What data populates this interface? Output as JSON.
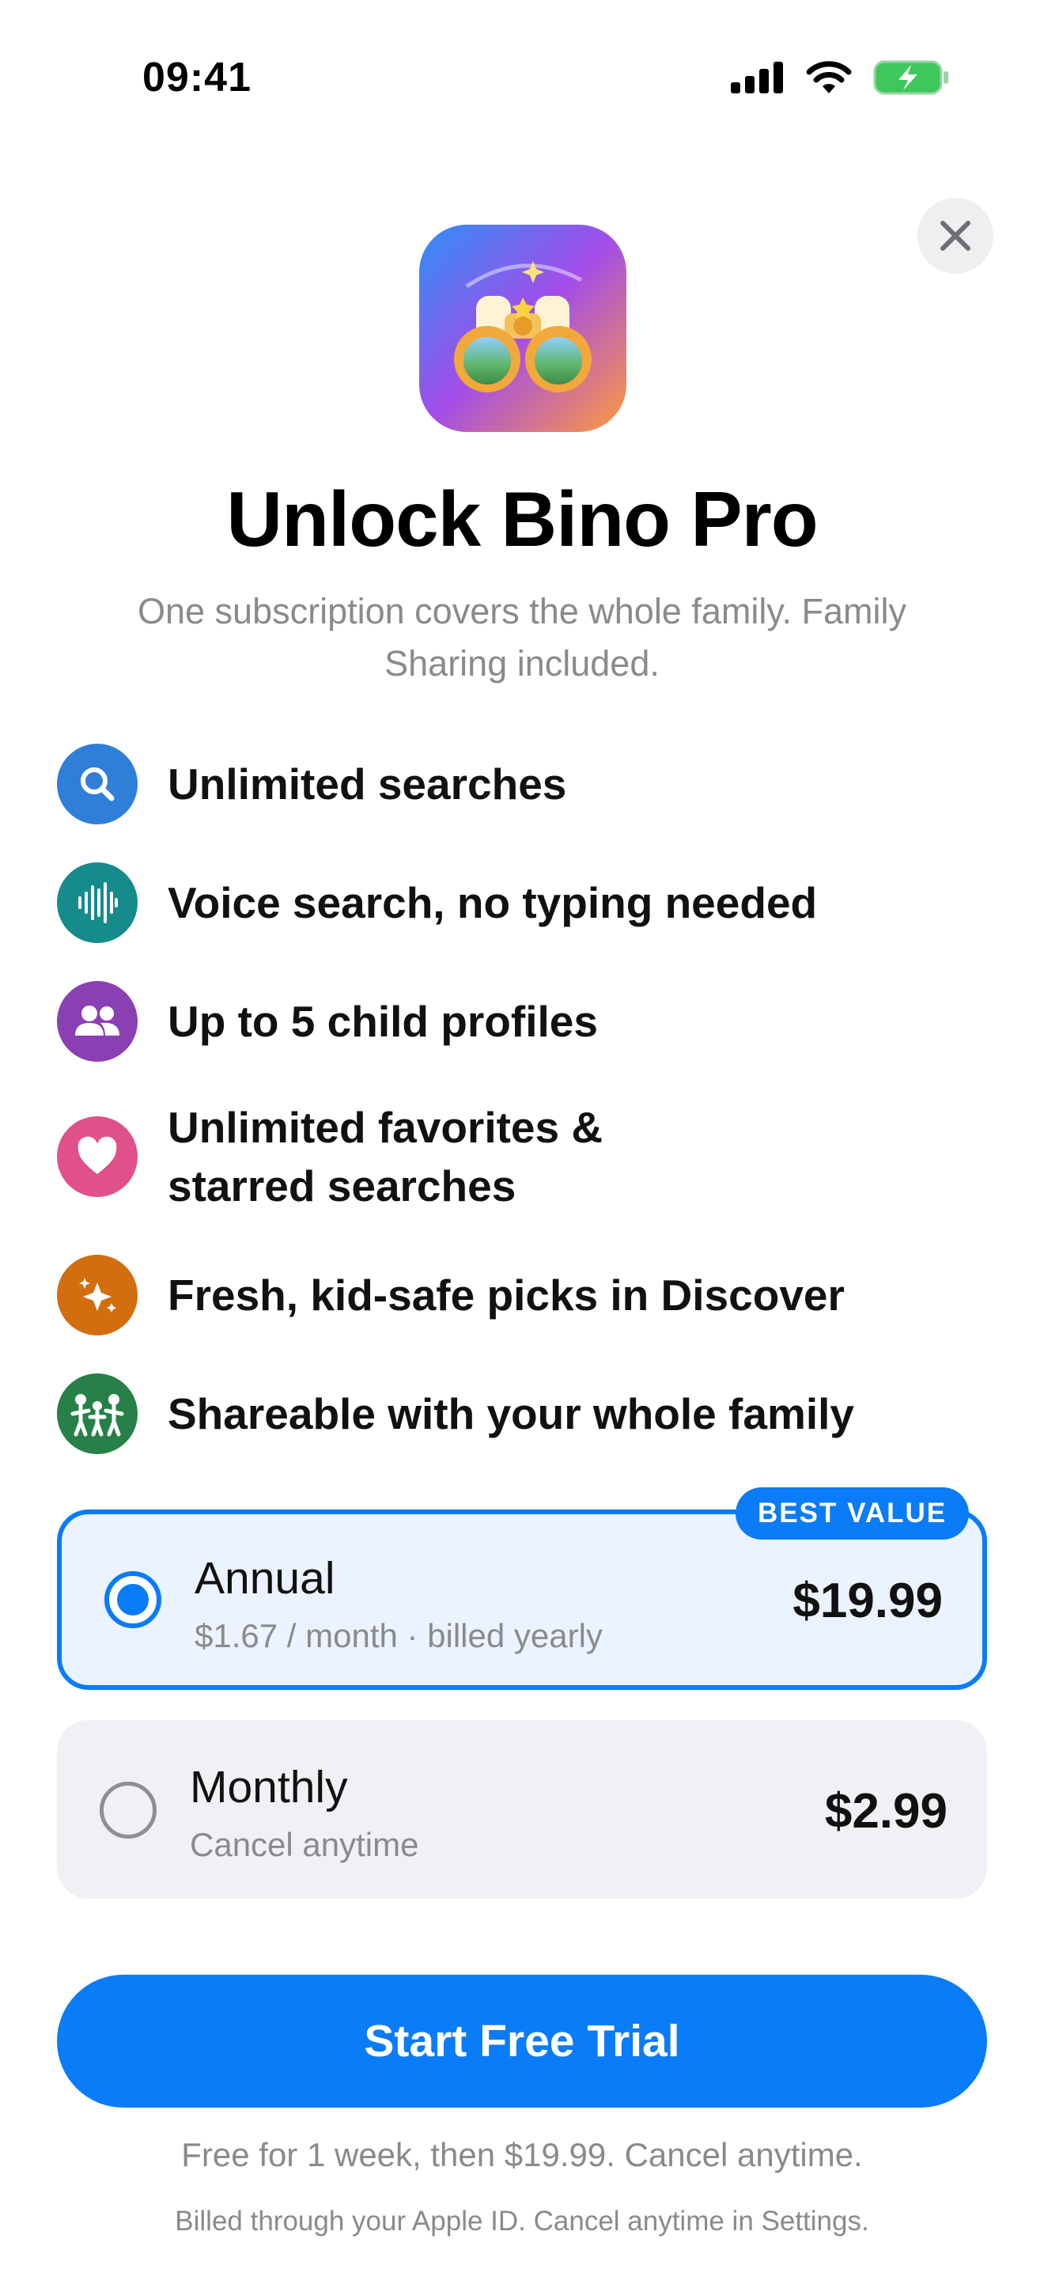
{
  "status_bar": {
    "time": "09:41",
    "icons": [
      "signal-icon",
      "wifi-icon",
      "battery-charging-icon"
    ]
  },
  "close": {
    "icon": "close-icon"
  },
  "app": {
    "icon": "binoculars-app-icon"
  },
  "header": {
    "title": "Unlock Bino Pro",
    "subtitle": "One subscription covers the whole family. Family Sharing included."
  },
  "features": [
    {
      "icon": "search-icon",
      "color": "#2f7fd8",
      "label": "Unlimited searches"
    },
    {
      "icon": "voice-waveform-icon",
      "color": "#168b8c",
      "label": "Voice search, no typing needed"
    },
    {
      "icon": "people-icon",
      "color": "#8a3fb3",
      "label": "Up to 5 child profiles"
    },
    {
      "icon": "heart-icon",
      "color": "#e0508a",
      "label": "Unlimited favorites & starred searches"
    },
    {
      "icon": "sparkles-icon",
      "color": "#d36e10",
      "label": "Fresh, kid-safe picks in Discover"
    },
    {
      "icon": "family-icon",
      "color": "#268047",
      "label": "Shareable with your whole family"
    }
  ],
  "plans": {
    "annual": {
      "badge": "BEST VALUE",
      "name": "Annual",
      "detail": "$1.67 / month · billed yearly",
      "price": "$19.99",
      "selected": true
    },
    "monthly": {
      "name": "Monthly",
      "detail": "Cancel anytime",
      "price": "$2.99",
      "selected": false
    }
  },
  "cta": {
    "label": "Start Free Trial"
  },
  "footer": {
    "trial_note": "Free for 1 week, then $19.99. Cancel anytime.",
    "billing_note": "Billed through your Apple ID. Cancel anytime in Settings."
  },
  "colors": {
    "accent": "#0a7cf7",
    "muted_text": "#8a8a8e"
  }
}
